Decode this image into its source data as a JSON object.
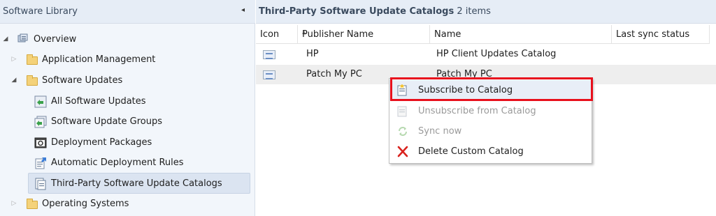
{
  "left_pane": {
    "title": "Software Library",
    "collapse_glyph": "◂",
    "tree": [
      {
        "label": "Overview",
        "level": 0,
        "expanded": true,
        "icon": "overview-icon"
      },
      {
        "label": "Application Management",
        "level": 1,
        "expanded": false,
        "icon": "folder-icon"
      },
      {
        "label": "Software Updates",
        "level": 1,
        "expanded": true,
        "icon": "folder-icon"
      },
      {
        "label": "All Software Updates",
        "level": 2,
        "icon": "all-updates-icon"
      },
      {
        "label": "Software Update Groups",
        "level": 2,
        "icon": "update-groups-icon"
      },
      {
        "label": "Deployment Packages",
        "level": 2,
        "icon": "deployment-packages-icon"
      },
      {
        "label": "Automatic Deployment Rules",
        "level": 2,
        "icon": "deployment-rules-icon"
      },
      {
        "label": "Third-Party Software Update Catalogs",
        "level": 2,
        "selected": true,
        "icon": "catalogs-icon"
      },
      {
        "label": "Operating Systems",
        "level": 1,
        "expanded": false,
        "icon": "folder-icon"
      }
    ]
  },
  "right_pane": {
    "title": "Third-Party Software Update Catalogs",
    "count": "2 items",
    "columns": [
      "Icon",
      "Publisher Name",
      "Name",
      "Last sync status"
    ],
    "sorted_column": "Publisher Name",
    "rows": [
      {
        "publisher": "HP",
        "name": "HP Client Updates Catalog",
        "status": ""
      },
      {
        "publisher": "Patch My PC",
        "name": "Patch My PC",
        "status": ""
      }
    ]
  },
  "context_menu": {
    "items": [
      {
        "label": "Subscribe to Catalog",
        "enabled": true,
        "icon": "subscribe-icon"
      },
      {
        "label": "Unsubscribe from Catalog",
        "enabled": false,
        "icon": "unsubscribe-icon"
      },
      {
        "label": "Sync now",
        "enabled": false,
        "icon": "sync-icon"
      },
      {
        "label": "Delete Custom Catalog",
        "enabled": true,
        "icon": "delete-icon"
      }
    ],
    "highlight_color": "#e8101c"
  },
  "colors": {
    "pane_bg": "#f2f6fb",
    "header_bg": "#e6edf6",
    "selection_bg": "#dbe4f1"
  }
}
